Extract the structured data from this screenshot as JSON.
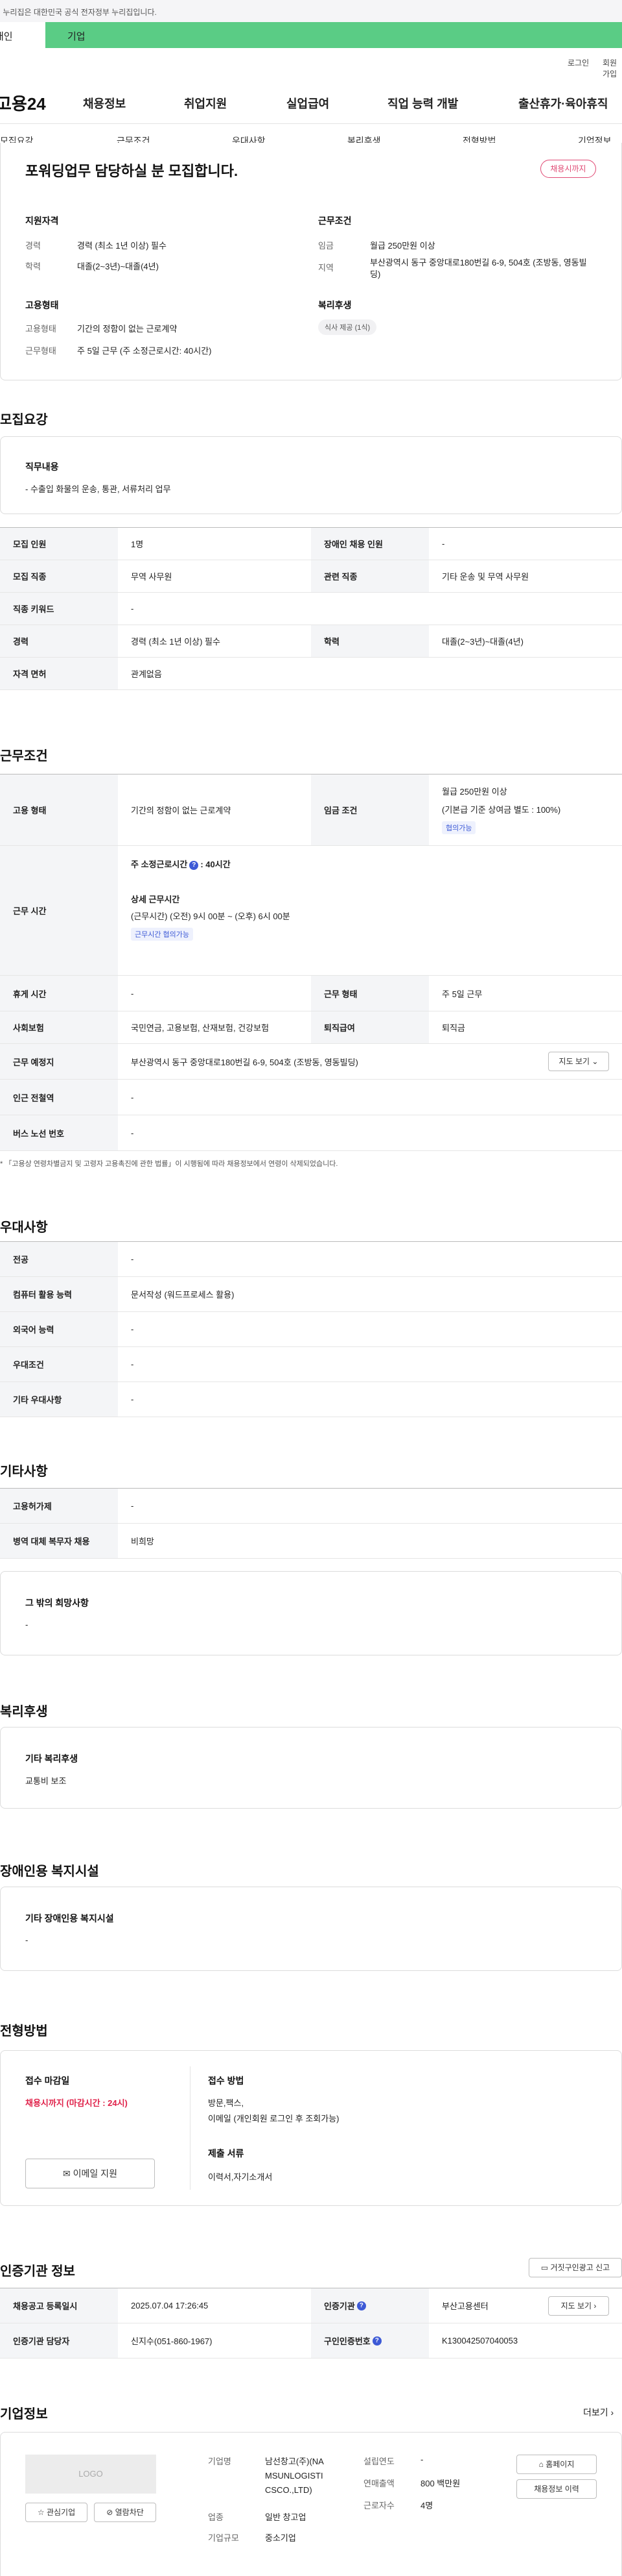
{
  "gov_banner": "이 누리집은 대한민국 공식 전자정부 누리집입니다.",
  "portal_tabs": {
    "individual": "개인",
    "company": "기업"
  },
  "util": {
    "login": "로그인",
    "signup": "회원가입"
  },
  "logo": "고용24",
  "gnb": [
    "채용정보",
    "취업지원",
    "실업급여",
    "직업 능력 개발",
    "출산휴가·육아휴직"
  ],
  "subtabs": [
    "모집요강",
    "근무조건",
    "우대사항",
    "복리후생",
    "전형방법",
    "기업정보"
  ],
  "summary": {
    "title": "포워딩업무 담당하실 분 모집합니다.",
    "deadline_chip": "채용시까지",
    "qual_head": "지원자격",
    "career_label": "경력",
    "career_value": "경력 (최소 1년 이상) 필수",
    "edu_label": "학력",
    "edu_value": "대졸(2~3년)~대졸(4년)",
    "cond_head": "근무조건",
    "wage_label": "임금",
    "wage_value": "월급 250만원 이상",
    "region_label": "지역",
    "region_value": "부산광역시 동구 중앙대로180번길 6-9, 504호 (조방동, 영동빌딩)",
    "employ_head": "고용형태",
    "etype_label": "고용형태",
    "etype_value": "기간의 정함이 없는 근로계약",
    "wtype_label": "근무형태",
    "wtype_value": "주 5일 근무 (주 소정근로시간: 40시간)",
    "welfare_head": "복리후생",
    "welfare_badge": "식사 제공 (1식)"
  },
  "recruit": {
    "title": "모집요강",
    "job_head": "직무내용",
    "job_desc": "- 수출입 화물의 운송, 통관, 서류처리 업무",
    "rows": {
      "headcount_k": "모집 인원",
      "headcount_v": "1명",
      "disabled_k": "장애인 채용 인원",
      "disabled_v": "-",
      "job_k": "모집 직종",
      "job_v": "무역 사무원",
      "related_k": "관련 직종",
      "related_v": "기타 운송 및 무역 사무원",
      "keyword_k": "직종 키워드",
      "keyword_v": "-",
      "career_k": "경력",
      "career_v": "경력 (최소 1년 이상) 필수",
      "edu_k": "학력",
      "edu_v": "대졸(2~3년)~대졸(4년)",
      "license_k": "자격 면허",
      "license_v": "관계없음"
    }
  },
  "work": {
    "title": "근무조건",
    "etype_k": "고용 형태",
    "etype_v": "기간의 정함이 없는 근로계약",
    "wage_k": "임금 조건",
    "wage_v1": "월급 250만원 이상",
    "wage_v2": "(기본급 기준 상여금 별도 : 100%)",
    "wage_chip": "협의가능",
    "hours_k": "근무 시간",
    "hours_main_pre": "주 소정근로시간",
    "hours_main_post": ": 40시간",
    "hours_detail_head": "상세 근무시간",
    "hours_detail": "(근무시간) (오전) 9시 00분 ~ (오후) 6시 00분",
    "hours_chip": "근무시간 협의가능",
    "rest_k": "휴게 시간",
    "rest_v": "-",
    "wform_k": "근무 형태",
    "wform_v": "주 5일 근무",
    "ins_k": "사회보험",
    "ins_v": "국민연금, 고용보험, 산재보험, 건강보험",
    "sev_k": "퇴직급여",
    "sev_v": "퇴직금",
    "place_k": "근무 예정지",
    "place_v": "부산광역시 동구 중앙대로180번길 6-9, 504호 (조방동, 영동빌딩)",
    "map_btn": "지도 보기",
    "subway_k": "인근 전철역",
    "subway_v": "-",
    "bus_k": "버스 노선 번호",
    "bus_v": "-",
    "note": "「고용상 연령차별금지 및 고령자 고용촉진에 관한 법률」이 시행됨에 따라 채용정보에서 연령이 삭제되었습니다."
  },
  "pref": {
    "title": "우대사항",
    "major_k": "전공",
    "major_v": "-",
    "pc_k": "컴퓨터 활용 능력",
    "pc_v": "문서작성 (워드프로세스 활용)",
    "lang_k": "외국어 능력",
    "lang_v": "-",
    "cond_k": "우대조건",
    "cond_v": "-",
    "etc_k": "기타 우대사항",
    "etc_v": "-"
  },
  "etc": {
    "title": "기타사항",
    "subsidy_k": "고용허가제",
    "subsidy_v": "-",
    "military_k": "병역 대체 복무자 채용",
    "military_v": "비희망",
    "hope_head": "그 밖의 희망사항",
    "hope_v": "-"
  },
  "welfare": {
    "title": "복리후생",
    "head": "기타 복리후생",
    "value": "교통비 보조"
  },
  "disab": {
    "title": "장애인용 복지시설",
    "head": "기타 장애인용 복지시설",
    "value": "-"
  },
  "screen": {
    "title": "전형방법",
    "deadline_head": "접수 마감일",
    "deadline_v": "채용시까지 (마감시간 : 24시)",
    "email_btn": "이메일 지원",
    "method_head": "접수 방법",
    "method_v1": "방문,팩스,",
    "method_v2": "이메일 (개인회원 로그인 후 조회가능)",
    "docs_head": "제출 서류",
    "docs_v": "이력서,자기소개서"
  },
  "agency": {
    "title": "인증기관 정보",
    "report_btn": "거짓구인광고 신고",
    "reg_k": "채용공고 등록일시",
    "reg_v": "2025.07.04 17:26:45",
    "org_k": "인증기관",
    "org_v": "부산고용센터",
    "map_btn": "지도 보기",
    "mgr_k": "인증기관 담당자",
    "mgr_v": "신지수(051-860-1967)",
    "num_k": "구인인증번호",
    "num_v": "K130042507040053"
  },
  "company": {
    "title": "기업정보",
    "more": "더보기",
    "logo_text": "LOGO",
    "fav_btn": "관심기업",
    "block_btn": "열람차단",
    "name_k": "기업명",
    "name_v": "남선창고(주)(NAMSUNLOGISTICSCO.,LTD)",
    "name_lines": [
      "남선창고(주)(NA",
      "MSUNLOGISTI",
      "CSCO.,LTD)"
    ],
    "type_k": "업종",
    "type_v": "일반 창고업",
    "size_k": "기업규모",
    "size_v": "중소기업",
    "year_k": "설립연도",
    "year_v": "-",
    "sales_k": "연매출액",
    "sales_v": "800 백만원",
    "emp_k": "근로자수",
    "emp_v": "4명",
    "home_btn": "홈페이지",
    "history_btn": "채용정보 이력"
  }
}
